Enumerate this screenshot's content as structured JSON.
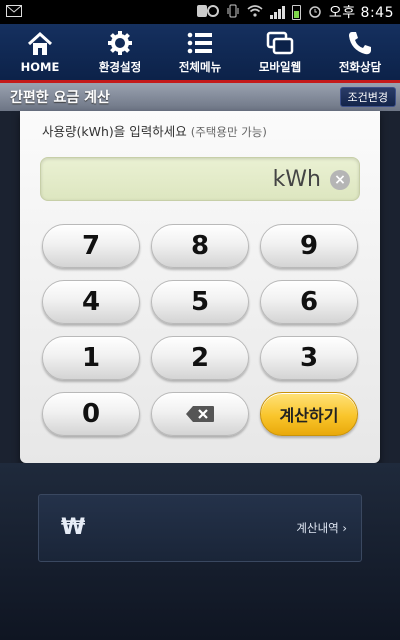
{
  "status_bar": {
    "time": "오후 8:45"
  },
  "nav": {
    "items": [
      {
        "label": "HOME",
        "icon": "home-icon"
      },
      {
        "label": "환경설정",
        "icon": "gear-icon"
      },
      {
        "label": "전체메뉴",
        "icon": "menu-list-icon"
      },
      {
        "label": "모바일웹",
        "icon": "windows-icon"
      },
      {
        "label": "전화상담",
        "icon": "phone-icon"
      }
    ]
  },
  "title_bar": {
    "title": "간편한 요금 계산",
    "condition_button": "조건변경"
  },
  "calculator": {
    "instruction": "사용량(kWh)을 입력하세요",
    "instruction_note": "(주택용만 가능)",
    "input_value": "",
    "unit": "kWh",
    "keys": [
      "7",
      "8",
      "9",
      "4",
      "5",
      "6",
      "1",
      "2",
      "3",
      "0"
    ],
    "calc_button": "계산하기"
  },
  "result": {
    "currency_symbol": "₩",
    "history_link": "계산내역 ›"
  },
  "colors": {
    "nav_bg": "#0c2249",
    "accent_red": "#c41a1a",
    "input_bg": "#eaf1d3",
    "calc_button": "#f9c52b"
  }
}
